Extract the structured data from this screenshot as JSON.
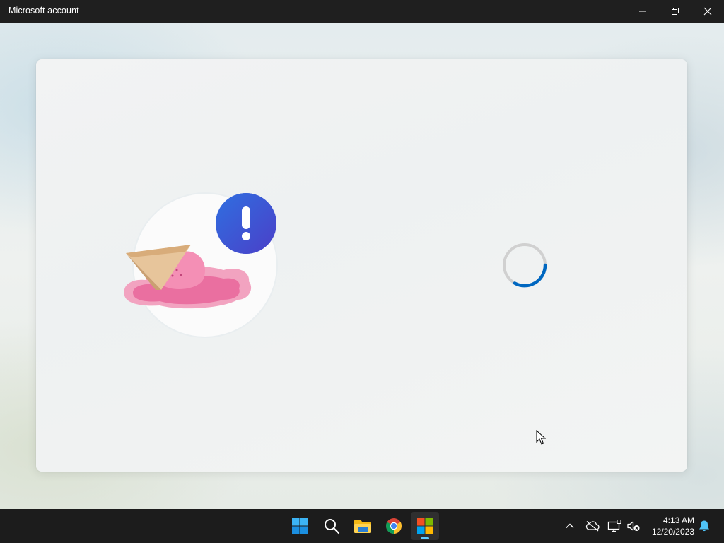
{
  "window": {
    "title": "Microsoft account",
    "controls": [
      "minimize-icon",
      "restore-icon",
      "close-icon"
    ]
  },
  "content": {
    "illustration": "dropped-ice-cream-error-illustration",
    "badge_icon": "exclamation-icon",
    "loading": true
  },
  "taskbar": {
    "apps": [
      {
        "name": "Start",
        "icon": "windows-start-icon"
      },
      {
        "name": "Search",
        "icon": "search-icon"
      },
      {
        "name": "File Explorer",
        "icon": "folder-icon"
      },
      {
        "name": "Google Chrome",
        "icon": "chrome-icon"
      },
      {
        "name": "Microsoft Store",
        "icon": "microsoft-logo-icon",
        "active": true
      }
    ],
    "tray": {
      "icons": [
        "chevron-up-icon",
        "onedrive-offline-icon",
        "network-icon",
        "volume-muted-icon",
        "notification-bell-icon"
      ],
      "time": "4:13 AM",
      "date": "12/20/2023"
    }
  },
  "colors": {
    "accent": "#0067c0",
    "spinner_track": "#d0d0d0",
    "badge": "#3a56d4",
    "taskbar_bg": "#1c1c1c",
    "titlebar_bg": "#1f1f1f"
  }
}
